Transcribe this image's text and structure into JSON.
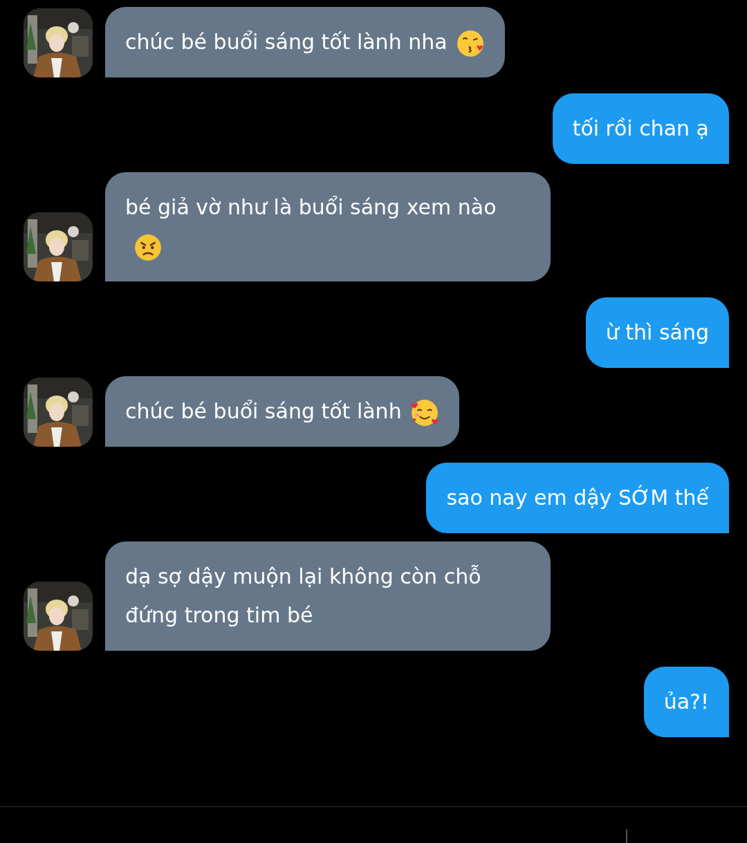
{
  "messages": [
    {
      "kind": "incoming",
      "text": "chúc bé buổi sáng tốt lành nha",
      "emoji": {
        "kind": "kiss"
      }
    },
    {
      "kind": "outgoing",
      "text": "tối rồi chan ạ"
    },
    {
      "kind": "incoming",
      "text": "bé giả vờ như là buổi sáng xem nào",
      "emoji": {
        "kind": "angry"
      }
    },
    {
      "kind": "outgoing",
      "text": "ừ thì sáng"
    },
    {
      "kind": "incoming",
      "text": "chúc bé buổi sáng tốt lành",
      "emoji": {
        "kind": "hearts"
      }
    },
    {
      "kind": "outgoing",
      "text": "sao nay em dậy SỚM thế"
    },
    {
      "kind": "incoming",
      "text": "dạ sợ dậy muộn lại không còn chỗ đứng trong tim bé"
    },
    {
      "kind": "outgoing",
      "text": "ủa?!"
    }
  ],
  "composer": {
    "focused": true
  }
}
